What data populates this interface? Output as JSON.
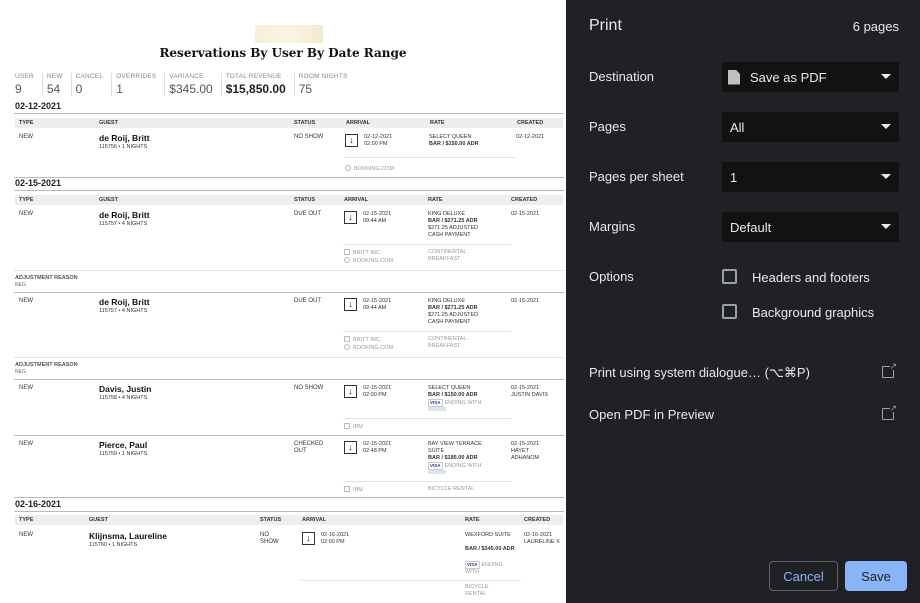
{
  "report": {
    "title": "Reservations By User By Date Range",
    "summary": [
      {
        "label": "USER",
        "value": "9"
      },
      {
        "label": "NEW",
        "value": "54"
      },
      {
        "label": "CANCEL",
        "value": "0"
      },
      {
        "label": "OVERRIDES",
        "value": "1"
      },
      {
        "label": "VARIANCE",
        "value": "$345.00"
      },
      {
        "label": "TOTAL REVENUE",
        "value": "$15,850.00"
      },
      {
        "label": "ROOM NIGHTS",
        "value": "75"
      }
    ],
    "columns": {
      "type": "TYPE",
      "guest": "GUEST",
      "status": "STATUS",
      "arrival": "ARRIVAL",
      "rate": "RATE",
      "created": "CREATED"
    },
    "adjustment_label": "ADJUSTMENT REASON",
    "adjustment_sub": "NEG",
    "groups": [
      {
        "date": "02-12-2021",
        "rows": [
          {
            "type": "NEW",
            "guest": "de Roij, Britt",
            "sub": "115756 • 1 NIGHTS",
            "status": "NO SHOW",
            "arr_date": "02-12-2021",
            "arr_time": "02:00 PM",
            "rate1": "SELECT QUEEN",
            "rate2": "BAR / $150.00 ADR",
            "created": "02-12-2021",
            "source": "BOOKING.COM"
          }
        ]
      },
      {
        "date": "02-15-2021",
        "rows": [
          {
            "type": "NEW",
            "guest": "de Roij, Britt",
            "sub": "115757 • 4 NIGHTS",
            "status": "DUE OUT",
            "arr_date": "02-15-2021",
            "arr_time": "09:44 AM",
            "rate1": "KING DELUXE",
            "rate2": "BAR / $271.25 ADR",
            "rate3": "$271.25 ADJUSTED",
            "rate4": "CASH PAYMENT",
            "created": "02-15-2021",
            "company": "BRITT INC.",
            "source": "BOOKING.COM",
            "package": "CONTINENTAL BREAKFAST"
          },
          {
            "type": "NEW",
            "guest": "de Roij, Britt",
            "sub": "115757 • 4 NIGHTS",
            "status": "DUE OUT",
            "arr_date": "02-15-2021",
            "arr_time": "09:44 AM",
            "rate1": "KING DELUXE",
            "rate2": "BAR / $271.25 ADR",
            "rate3": "$271.25 ADJUSTED",
            "rate4": "CASH PAYMENT",
            "created": "02-15-2021",
            "company": "BRITT INC.",
            "source": "BOOKING.COM",
            "package": "CONTINENTAL BREAKFAST"
          },
          {
            "type": "NEW",
            "guest": "Davis, Justin",
            "sub": "115758 • 4 NIGHTS",
            "status": "NO SHOW",
            "arr_date": "02-15-2021",
            "arr_time": "02:00 PM",
            "rate1": "SELECT QUEEN",
            "rate2": "BAR / $150.00 ADR",
            "rate3": "ENDING WITH",
            "created": "02-15-2021",
            "created_by": "JUSTIN DAVIS",
            "company": "IBM"
          },
          {
            "type": "NEW",
            "guest": "Pierce, Paul",
            "sub": "115759 • 1 NIGHTS",
            "status": "CHECKED OUT",
            "arr_date": "02-15-2021",
            "arr_time": "02:48 PM",
            "rate1": "BAY VIEW TERRACE SUITE",
            "rate2": "BAR / $185.00 ADR",
            "rate3": "ENDING WITH",
            "created": "02-15-2021",
            "created_by": "HAYET ADHANOM",
            "company": "IBM",
            "package": "BICYCLE RENTAL"
          }
        ]
      },
      {
        "date": "02-16-2021",
        "rows": [
          {
            "type": "NEW",
            "guest": "Klijnsma, Laureline",
            "sub": "115760 • 1 NIGHTS",
            "status": "NO SHOW",
            "arr_date": "02-16-2021",
            "arr_time": "02:00 PM",
            "rate1": "WEXFORD SUITE",
            "rate2": "BAR / $345.00 ADR",
            "rate3": "ENDING WITH",
            "created": "02-16-2021",
            "created_by": "LAURELINE X",
            "package": "BICYCLE RENTAL"
          }
        ]
      }
    ]
  },
  "print_panel": {
    "title": "Print",
    "page_count": "6 pages",
    "destination_label": "Destination",
    "destination_value": "Save as PDF",
    "pages_label": "Pages",
    "pages_value": "All",
    "per_sheet_label": "Pages per sheet",
    "per_sheet_value": "1",
    "margins_label": "Margins",
    "margins_value": "Default",
    "options_label": "Options",
    "opt_headers": "Headers and footers",
    "opt_background": "Background graphics",
    "system_dialog": "Print using system dialogue… (⌥⌘P)",
    "open_preview": "Open PDF in Preview",
    "cancel": "Cancel",
    "save": "Save"
  },
  "colors": {
    "panel_bg": "#202124",
    "accent": "#8ab4f8",
    "select_bg": "#121212"
  }
}
